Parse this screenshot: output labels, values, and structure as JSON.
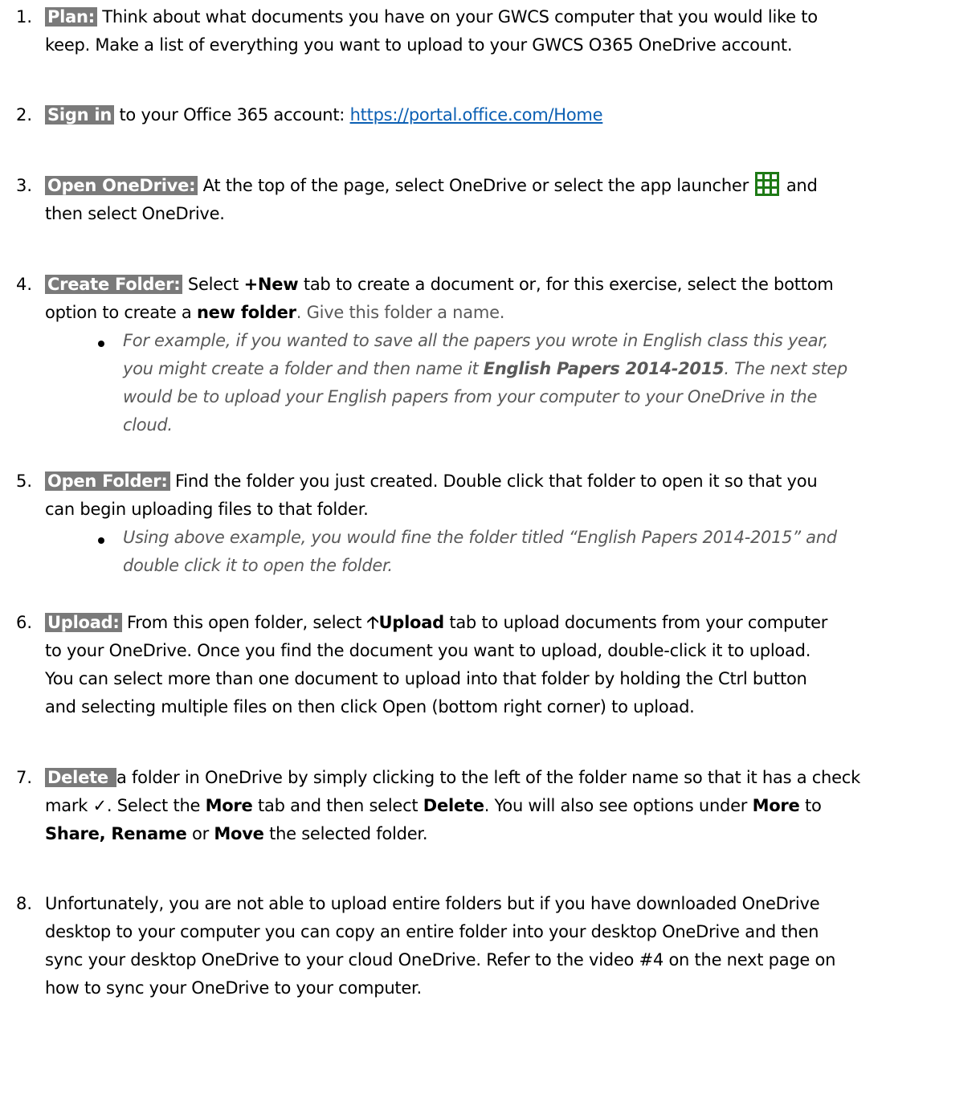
{
  "steps": [
    {
      "num": "1.",
      "label": "Plan:",
      "line1": " Think about what documents you have on your GWCS computer that you would like to",
      "line2": "keep.  Make a list of everything you want to upload to your GWCS O365 OneDrive account."
    },
    {
      "num": "2.",
      "label": "Sign in",
      "text": " to your Office 365 account:  ",
      "link": "https://portal.office.com/Home"
    },
    {
      "num": "3.",
      "label": "Open OneDrive:",
      "line1a": "  At the top of the page, select OneDrive or select the app launcher ",
      "line1b": " and",
      "line2": "then select OneDrive.",
      "icon": "app-launcher-grid-icon"
    },
    {
      "num": "4.",
      "label": "Create Folder:",
      "line1a": "  Select ",
      "new_tab": "+New",
      "line1b": " tab to create a document or, for this exercise, select the bottom",
      "line2a": "option to create a ",
      "new_folder": "new folder",
      "line2b": ".  Give this folder a name.",
      "bullet_l1": "For example, if you wanted to save all the papers you wrote in English class this year,",
      "bullet_l2a": "you might create a folder and then name it ",
      "bullet_bold": "English Papers 2014-2015",
      "bullet_l2b": ".  The next step",
      "bullet_l3": "would be to upload your English papers from your computer to your OneDrive in the",
      "bullet_l4": "cloud."
    },
    {
      "num": "5.",
      "label": "Open Folder:",
      "line1": "   Find the folder you just created.  Double click that folder to open it so that you",
      "line2": "can begin uploading files to that folder.",
      "bullet_l1": "Using above example, you would fine the folder titled “English Papers 2014-2015” and",
      "bullet_l2": "double click it to open the folder."
    },
    {
      "num": "6.",
      "label": "Upload:",
      "line1a": "  From this open folder, select ",
      "upload_tab": "Upload",
      "line1b": " tab to upload documents from your computer",
      "line2": "to your OneDrive.  Once you find the document you want to upload, double-click it to upload.",
      "line3": "You can select more than one document to upload into that folder by holding the Ctrl button",
      "line4": "and selecting multiple files on then click Open (bottom right corner) to upload.",
      "icon": "upload-arrow-icon"
    },
    {
      "num": "7.",
      "label": "Delete ",
      "line1": "a folder in OneDrive by simply clicking to the left of the folder name so that it has a check",
      "line2a": "mark ",
      "check": "✓",
      "line2b": ".  Select the ",
      "more": "More",
      "line2c": " tab and then select ",
      "delete": "Delete",
      "line2d": ".  You will also see options under ",
      "more2": "More",
      "line2e": " to",
      "share_rename": "Share, Rename",
      "line3a": " or ",
      "move": "Move",
      "line3b": " the selected folder."
    },
    {
      "num": "8.",
      "line1": "Unfortunately, you are not able to upload entire folders but if you have downloaded OneDrive",
      "line2": "desktop to your computer you can copy an entire folder into your desktop OneDrive and then",
      "line3": "sync your desktop OneDrive to your cloud OneDrive.  Refer to the video #4 on the next page on",
      "line4": "how to sync your OneDrive to your computer."
    }
  ]
}
